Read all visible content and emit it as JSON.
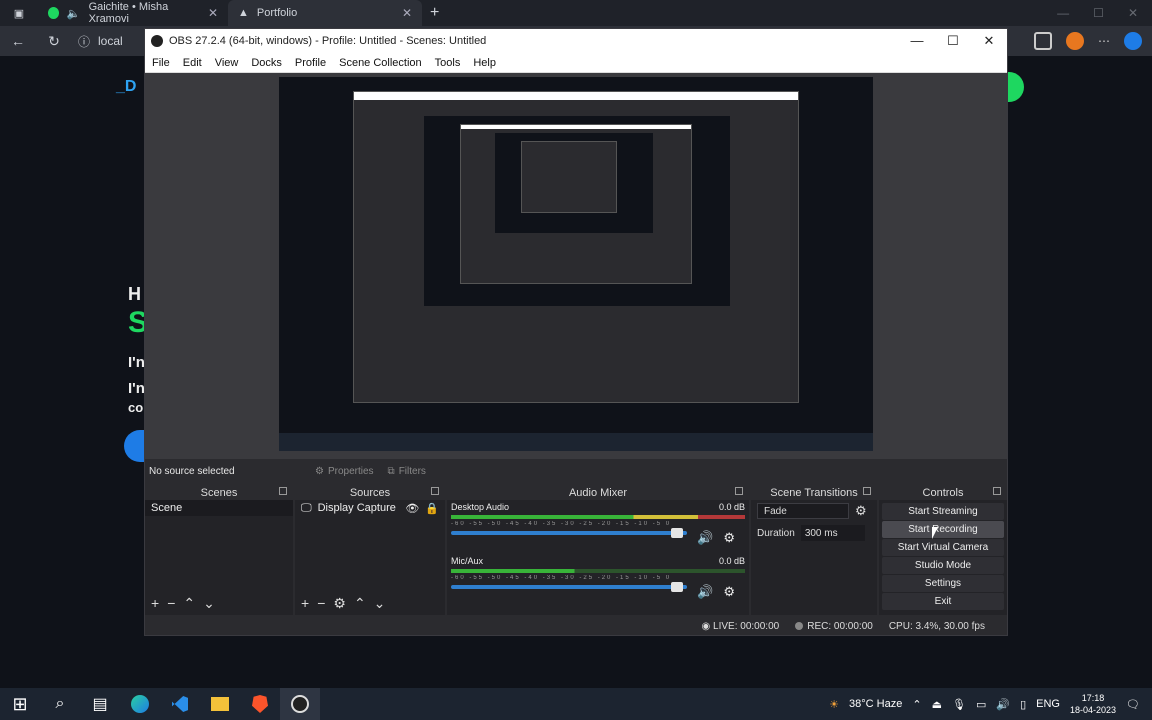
{
  "browser": {
    "tabs": [
      {
        "label": "Gaichite • Misha Xramovi"
      },
      {
        "label": "Portfolio"
      }
    ],
    "address": "local",
    "close_glyph": "✕",
    "new_tab_glyph": "+"
  },
  "page": {
    "heading": "_D",
    "lines": [
      "H",
      "S",
      "I'n",
      "I'n",
      "co"
    ]
  },
  "obs": {
    "title": "OBS 27.2.4 (64-bit, windows) - Profile: Untitled - Scenes: Untitled",
    "menu": [
      "File",
      "Edit",
      "View",
      "Docks",
      "Profile",
      "Scene Collection",
      "Tools",
      "Help"
    ],
    "no_source": "No source selected",
    "properties_label": "Properties",
    "filters_label": "Filters",
    "docks": {
      "scenes": {
        "title": "Scenes",
        "items": [
          "Scene"
        ]
      },
      "sources": {
        "title": "Sources",
        "items": [
          "Display Capture"
        ]
      },
      "mixer": {
        "title": "Audio Mixer",
        "channels": [
          {
            "name": "Desktop Audio",
            "db": "0.0 dB"
          },
          {
            "name": "Mic/Aux",
            "db": "0.0 dB"
          }
        ],
        "ticks": "-60 -55 -50 -45 -40 -35 -30 -25 -20 -15 -10 -5 0"
      },
      "transitions": {
        "title": "Scene Transitions",
        "type": "Fade",
        "duration_label": "Duration",
        "duration_value": "300 ms"
      },
      "controls": {
        "title": "Controls",
        "buttons": [
          "Start Streaming",
          "Start Recording",
          "Start Virtual Camera",
          "Studio Mode",
          "Settings",
          "Exit"
        ]
      }
    },
    "status": {
      "live": "LIVE: 00:00:00",
      "rec": "REC: 00:00:00",
      "cpu": "CPU: 3.4%, 30.00 fps"
    }
  },
  "taskbar": {
    "weather": "38°C Haze",
    "lang": "ENG",
    "time": "17:18",
    "date": "18-04-2023"
  },
  "colors": {
    "accent": "#2ea3f2",
    "green": "#1ed760"
  }
}
